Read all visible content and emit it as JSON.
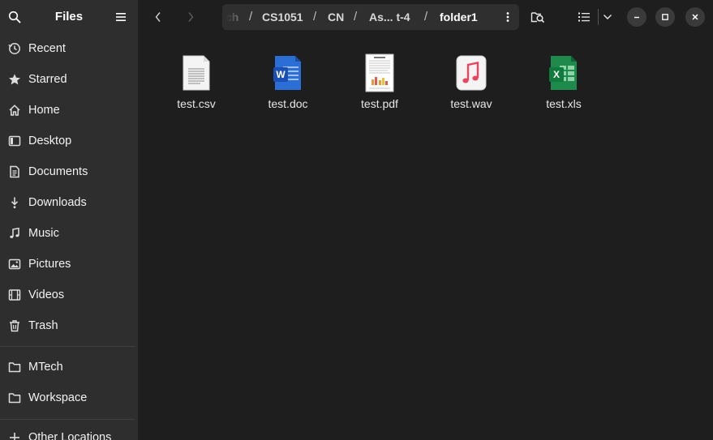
{
  "sidebar": {
    "title": "Files",
    "items": [
      {
        "label": "Recent",
        "icon": "clock-icon"
      },
      {
        "label": "Starred",
        "icon": "star-icon"
      },
      {
        "label": "Home",
        "icon": "home-icon"
      },
      {
        "label": "Desktop",
        "icon": "desktop-icon"
      },
      {
        "label": "Documents",
        "icon": "document-icon"
      },
      {
        "label": "Downloads",
        "icon": "download-icon"
      },
      {
        "label": "Music",
        "icon": "music-icon"
      },
      {
        "label": "Pictures",
        "icon": "picture-icon"
      },
      {
        "label": "Videos",
        "icon": "video-icon"
      },
      {
        "label": "Trash",
        "icon": "trash-icon"
      }
    ],
    "bookmarks": [
      {
        "label": "MTech",
        "icon": "folder-icon"
      },
      {
        "label": "Workspace",
        "icon": "folder-icon"
      }
    ],
    "other_locations": {
      "label": "Other Locations",
      "icon": "plus-icon"
    }
  },
  "pathbar": {
    "crumbs": [
      "ch",
      "CS1051",
      "CN",
      "As... t-4",
      "folder1"
    ],
    "separator": "/"
  },
  "files": [
    {
      "name": "test.csv",
      "icon": "text-file-icon"
    },
    {
      "name": "test.doc",
      "icon": "word-document-icon"
    },
    {
      "name": "test.pdf",
      "icon": "pdf-document-icon"
    },
    {
      "name": "test.wav",
      "icon": "audio-file-icon"
    },
    {
      "name": "test.xls",
      "icon": "excel-spreadsheet-icon"
    }
  ],
  "colors": {
    "sidebar_bg": "#2e2e2e",
    "main_bg": "#1e1e1e",
    "word_blue": "#2b6fd6",
    "excel_green": "#1e8a4c",
    "music_red": "#e8455e"
  }
}
